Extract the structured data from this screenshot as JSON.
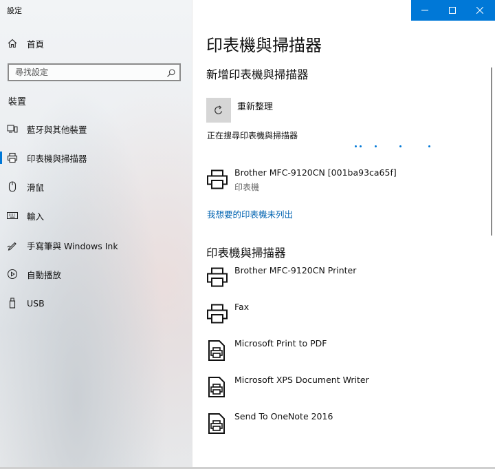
{
  "app": {
    "title": "設定"
  },
  "sidebar": {
    "home_label": "首頁",
    "search": {
      "placeholder": "尋找設定"
    },
    "section": "裝置",
    "items": [
      {
        "label": "藍牙與其他裝置",
        "icon": "bluetooth-device-icon"
      },
      {
        "label": "印表機與掃描器",
        "icon": "printer-icon",
        "selected": true
      },
      {
        "label": "滑鼠",
        "icon": "mouse-icon"
      },
      {
        "label": "輸入",
        "icon": "keyboard-icon"
      },
      {
        "label": "手寫筆與 Windows Ink",
        "icon": "pen-icon"
      },
      {
        "label": "自動播放",
        "icon": "autoplay-icon"
      },
      {
        "label": "USB",
        "icon": "usb-icon"
      }
    ]
  },
  "window_controls": {
    "minimize": "—",
    "maximize": "☐",
    "close": "✕"
  },
  "main": {
    "title": "印表機與掃描器",
    "add_section": {
      "heading": "新增印表機與掃描器",
      "refresh_label": "重新整理",
      "searching_text": "正在搜尋印表機與掃描器",
      "found_device": {
        "name": "Brother MFC-9120CN [001ba93ca65f]",
        "type": "印表機"
      },
      "not_listed_link": "我想要的印表機未列出"
    },
    "printers_section": {
      "heading": "印表機與掃描器",
      "devices": [
        {
          "name": "Brother MFC-9120CN Printer",
          "icon": "printer-icon"
        },
        {
          "name": "Fax",
          "icon": "printer-icon"
        },
        {
          "name": "Microsoft Print to PDF",
          "icon": "document-printer-icon"
        },
        {
          "name": "Microsoft XPS Document Writer",
          "icon": "document-printer-icon"
        },
        {
          "name": "Send To OneNote 2016",
          "icon": "document-printer-icon"
        }
      ]
    }
  },
  "colors": {
    "accent": "#0078d7",
    "link": "#0063b1",
    "refresh_bg": "#d6d6d6"
  }
}
